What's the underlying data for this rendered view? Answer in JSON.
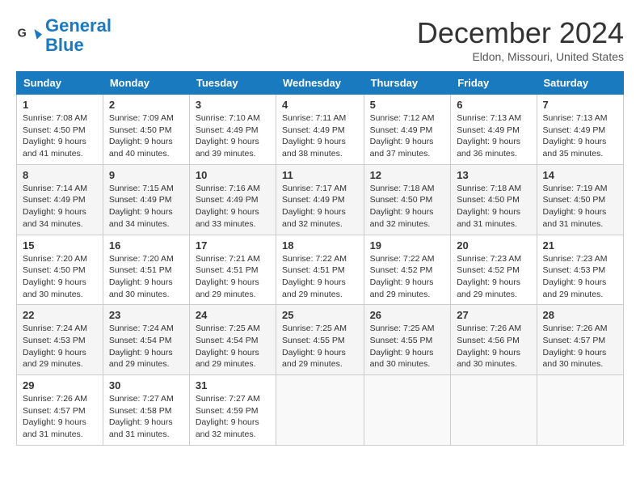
{
  "logo": {
    "text_general": "General",
    "text_blue": "Blue"
  },
  "title": "December 2024",
  "subtitle": "Eldon, Missouri, United States",
  "calendar": {
    "headers": [
      "Sunday",
      "Monday",
      "Tuesday",
      "Wednesday",
      "Thursday",
      "Friday",
      "Saturday"
    ],
    "rows": [
      [
        {
          "day": "1",
          "sunrise": "Sunrise: 7:08 AM",
          "sunset": "Sunset: 4:50 PM",
          "daylight": "Daylight: 9 hours and 41 minutes."
        },
        {
          "day": "2",
          "sunrise": "Sunrise: 7:09 AM",
          "sunset": "Sunset: 4:50 PM",
          "daylight": "Daylight: 9 hours and 40 minutes."
        },
        {
          "day": "3",
          "sunrise": "Sunrise: 7:10 AM",
          "sunset": "Sunset: 4:49 PM",
          "daylight": "Daylight: 9 hours and 39 minutes."
        },
        {
          "day": "4",
          "sunrise": "Sunrise: 7:11 AM",
          "sunset": "Sunset: 4:49 PM",
          "daylight": "Daylight: 9 hours and 38 minutes."
        },
        {
          "day": "5",
          "sunrise": "Sunrise: 7:12 AM",
          "sunset": "Sunset: 4:49 PM",
          "daylight": "Daylight: 9 hours and 37 minutes."
        },
        {
          "day": "6",
          "sunrise": "Sunrise: 7:13 AM",
          "sunset": "Sunset: 4:49 PM",
          "daylight": "Daylight: 9 hours and 36 minutes."
        },
        {
          "day": "7",
          "sunrise": "Sunrise: 7:13 AM",
          "sunset": "Sunset: 4:49 PM",
          "daylight": "Daylight: 9 hours and 35 minutes."
        }
      ],
      [
        {
          "day": "8",
          "sunrise": "Sunrise: 7:14 AM",
          "sunset": "Sunset: 4:49 PM",
          "daylight": "Daylight: 9 hours and 34 minutes."
        },
        {
          "day": "9",
          "sunrise": "Sunrise: 7:15 AM",
          "sunset": "Sunset: 4:49 PM",
          "daylight": "Daylight: 9 hours and 34 minutes."
        },
        {
          "day": "10",
          "sunrise": "Sunrise: 7:16 AM",
          "sunset": "Sunset: 4:49 PM",
          "daylight": "Daylight: 9 hours and 33 minutes."
        },
        {
          "day": "11",
          "sunrise": "Sunrise: 7:17 AM",
          "sunset": "Sunset: 4:49 PM",
          "daylight": "Daylight: 9 hours and 32 minutes."
        },
        {
          "day": "12",
          "sunrise": "Sunrise: 7:18 AM",
          "sunset": "Sunset: 4:50 PM",
          "daylight": "Daylight: 9 hours and 32 minutes."
        },
        {
          "day": "13",
          "sunrise": "Sunrise: 7:18 AM",
          "sunset": "Sunset: 4:50 PM",
          "daylight": "Daylight: 9 hours and 31 minutes."
        },
        {
          "day": "14",
          "sunrise": "Sunrise: 7:19 AM",
          "sunset": "Sunset: 4:50 PM",
          "daylight": "Daylight: 9 hours and 31 minutes."
        }
      ],
      [
        {
          "day": "15",
          "sunrise": "Sunrise: 7:20 AM",
          "sunset": "Sunset: 4:50 PM",
          "daylight": "Daylight: 9 hours and 30 minutes."
        },
        {
          "day": "16",
          "sunrise": "Sunrise: 7:20 AM",
          "sunset": "Sunset: 4:51 PM",
          "daylight": "Daylight: 9 hours and 30 minutes."
        },
        {
          "day": "17",
          "sunrise": "Sunrise: 7:21 AM",
          "sunset": "Sunset: 4:51 PM",
          "daylight": "Daylight: 9 hours and 29 minutes."
        },
        {
          "day": "18",
          "sunrise": "Sunrise: 7:22 AM",
          "sunset": "Sunset: 4:51 PM",
          "daylight": "Daylight: 9 hours and 29 minutes."
        },
        {
          "day": "19",
          "sunrise": "Sunrise: 7:22 AM",
          "sunset": "Sunset: 4:52 PM",
          "daylight": "Daylight: 9 hours and 29 minutes."
        },
        {
          "day": "20",
          "sunrise": "Sunrise: 7:23 AM",
          "sunset": "Sunset: 4:52 PM",
          "daylight": "Daylight: 9 hours and 29 minutes."
        },
        {
          "day": "21",
          "sunrise": "Sunrise: 7:23 AM",
          "sunset": "Sunset: 4:53 PM",
          "daylight": "Daylight: 9 hours and 29 minutes."
        }
      ],
      [
        {
          "day": "22",
          "sunrise": "Sunrise: 7:24 AM",
          "sunset": "Sunset: 4:53 PM",
          "daylight": "Daylight: 9 hours and 29 minutes."
        },
        {
          "day": "23",
          "sunrise": "Sunrise: 7:24 AM",
          "sunset": "Sunset: 4:54 PM",
          "daylight": "Daylight: 9 hours and 29 minutes."
        },
        {
          "day": "24",
          "sunrise": "Sunrise: 7:25 AM",
          "sunset": "Sunset: 4:54 PM",
          "daylight": "Daylight: 9 hours and 29 minutes."
        },
        {
          "day": "25",
          "sunrise": "Sunrise: 7:25 AM",
          "sunset": "Sunset: 4:55 PM",
          "daylight": "Daylight: 9 hours and 29 minutes."
        },
        {
          "day": "26",
          "sunrise": "Sunrise: 7:25 AM",
          "sunset": "Sunset: 4:55 PM",
          "daylight": "Daylight: 9 hours and 30 minutes."
        },
        {
          "day": "27",
          "sunrise": "Sunrise: 7:26 AM",
          "sunset": "Sunset: 4:56 PM",
          "daylight": "Daylight: 9 hours and 30 minutes."
        },
        {
          "day": "28",
          "sunrise": "Sunrise: 7:26 AM",
          "sunset": "Sunset: 4:57 PM",
          "daylight": "Daylight: 9 hours and 30 minutes."
        }
      ],
      [
        {
          "day": "29",
          "sunrise": "Sunrise: 7:26 AM",
          "sunset": "Sunset: 4:57 PM",
          "daylight": "Daylight: 9 hours and 31 minutes."
        },
        {
          "day": "30",
          "sunrise": "Sunrise: 7:27 AM",
          "sunset": "Sunset: 4:58 PM",
          "daylight": "Daylight: 9 hours and 31 minutes."
        },
        {
          "day": "31",
          "sunrise": "Sunrise: 7:27 AM",
          "sunset": "Sunset: 4:59 PM",
          "daylight": "Daylight: 9 hours and 32 minutes."
        },
        null,
        null,
        null,
        null
      ]
    ]
  }
}
